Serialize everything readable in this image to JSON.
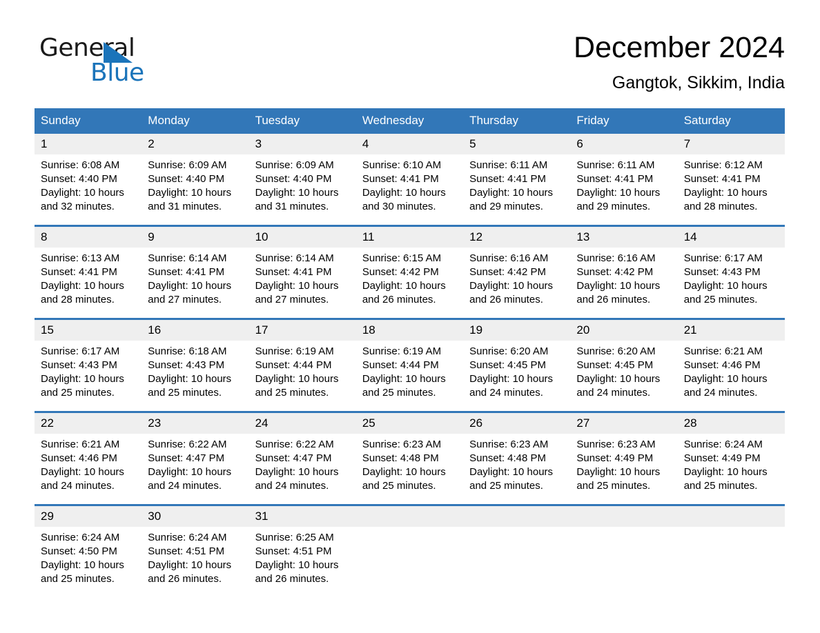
{
  "brand": {
    "name_part1": "General",
    "name_part2": "Blue",
    "logo_icon": "triangle-logo-mark",
    "accent_color": "#1b74ba"
  },
  "header": {
    "title": "December 2024",
    "subtitle": "Gangtok, Sikkim, India"
  },
  "colors": {
    "header_blue": "#3277b8",
    "daynum_band": "#efefef",
    "text": "#000000"
  },
  "weekday_headers": [
    "Sunday",
    "Monday",
    "Tuesday",
    "Wednesday",
    "Thursday",
    "Friday",
    "Saturday"
  ],
  "weeks": [
    [
      {
        "day": "1",
        "sunrise": "Sunrise: 6:08 AM",
        "sunset": "Sunset: 4:40 PM",
        "daylight": "Daylight: 10 hours and 32 minutes."
      },
      {
        "day": "2",
        "sunrise": "Sunrise: 6:09 AM",
        "sunset": "Sunset: 4:40 PM",
        "daylight": "Daylight: 10 hours and 31 minutes."
      },
      {
        "day": "3",
        "sunrise": "Sunrise: 6:09 AM",
        "sunset": "Sunset: 4:40 PM",
        "daylight": "Daylight: 10 hours and 31 minutes."
      },
      {
        "day": "4",
        "sunrise": "Sunrise: 6:10 AM",
        "sunset": "Sunset: 4:41 PM",
        "daylight": "Daylight: 10 hours and 30 minutes."
      },
      {
        "day": "5",
        "sunrise": "Sunrise: 6:11 AM",
        "sunset": "Sunset: 4:41 PM",
        "daylight": "Daylight: 10 hours and 29 minutes."
      },
      {
        "day": "6",
        "sunrise": "Sunrise: 6:11 AM",
        "sunset": "Sunset: 4:41 PM",
        "daylight": "Daylight: 10 hours and 29 minutes."
      },
      {
        "day": "7",
        "sunrise": "Sunrise: 6:12 AM",
        "sunset": "Sunset: 4:41 PM",
        "daylight": "Daylight: 10 hours and 28 minutes."
      }
    ],
    [
      {
        "day": "8",
        "sunrise": "Sunrise: 6:13 AM",
        "sunset": "Sunset: 4:41 PM",
        "daylight": "Daylight: 10 hours and 28 minutes."
      },
      {
        "day": "9",
        "sunrise": "Sunrise: 6:14 AM",
        "sunset": "Sunset: 4:41 PM",
        "daylight": "Daylight: 10 hours and 27 minutes."
      },
      {
        "day": "10",
        "sunrise": "Sunrise: 6:14 AM",
        "sunset": "Sunset: 4:41 PM",
        "daylight": "Daylight: 10 hours and 27 minutes."
      },
      {
        "day": "11",
        "sunrise": "Sunrise: 6:15 AM",
        "sunset": "Sunset: 4:42 PM",
        "daylight": "Daylight: 10 hours and 26 minutes."
      },
      {
        "day": "12",
        "sunrise": "Sunrise: 6:16 AM",
        "sunset": "Sunset: 4:42 PM",
        "daylight": "Daylight: 10 hours and 26 minutes."
      },
      {
        "day": "13",
        "sunrise": "Sunrise: 6:16 AM",
        "sunset": "Sunset: 4:42 PM",
        "daylight": "Daylight: 10 hours and 26 minutes."
      },
      {
        "day": "14",
        "sunrise": "Sunrise: 6:17 AM",
        "sunset": "Sunset: 4:43 PM",
        "daylight": "Daylight: 10 hours and 25 minutes."
      }
    ],
    [
      {
        "day": "15",
        "sunrise": "Sunrise: 6:17 AM",
        "sunset": "Sunset: 4:43 PM",
        "daylight": "Daylight: 10 hours and 25 minutes."
      },
      {
        "day": "16",
        "sunrise": "Sunrise: 6:18 AM",
        "sunset": "Sunset: 4:43 PM",
        "daylight": "Daylight: 10 hours and 25 minutes."
      },
      {
        "day": "17",
        "sunrise": "Sunrise: 6:19 AM",
        "sunset": "Sunset: 4:44 PM",
        "daylight": "Daylight: 10 hours and 25 minutes."
      },
      {
        "day": "18",
        "sunrise": "Sunrise: 6:19 AM",
        "sunset": "Sunset: 4:44 PM",
        "daylight": "Daylight: 10 hours and 25 minutes."
      },
      {
        "day": "19",
        "sunrise": "Sunrise: 6:20 AM",
        "sunset": "Sunset: 4:45 PM",
        "daylight": "Daylight: 10 hours and 24 minutes."
      },
      {
        "day": "20",
        "sunrise": "Sunrise: 6:20 AM",
        "sunset": "Sunset: 4:45 PM",
        "daylight": "Daylight: 10 hours and 24 minutes."
      },
      {
        "day": "21",
        "sunrise": "Sunrise: 6:21 AM",
        "sunset": "Sunset: 4:46 PM",
        "daylight": "Daylight: 10 hours and 24 minutes."
      }
    ],
    [
      {
        "day": "22",
        "sunrise": "Sunrise: 6:21 AM",
        "sunset": "Sunset: 4:46 PM",
        "daylight": "Daylight: 10 hours and 24 minutes."
      },
      {
        "day": "23",
        "sunrise": "Sunrise: 6:22 AM",
        "sunset": "Sunset: 4:47 PM",
        "daylight": "Daylight: 10 hours and 24 minutes."
      },
      {
        "day": "24",
        "sunrise": "Sunrise: 6:22 AM",
        "sunset": "Sunset: 4:47 PM",
        "daylight": "Daylight: 10 hours and 24 minutes."
      },
      {
        "day": "25",
        "sunrise": "Sunrise: 6:23 AM",
        "sunset": "Sunset: 4:48 PM",
        "daylight": "Daylight: 10 hours and 25 minutes."
      },
      {
        "day": "26",
        "sunrise": "Sunrise: 6:23 AM",
        "sunset": "Sunset: 4:48 PM",
        "daylight": "Daylight: 10 hours and 25 minutes."
      },
      {
        "day": "27",
        "sunrise": "Sunrise: 6:23 AM",
        "sunset": "Sunset: 4:49 PM",
        "daylight": "Daylight: 10 hours and 25 minutes."
      },
      {
        "day": "28",
        "sunrise": "Sunrise: 6:24 AM",
        "sunset": "Sunset: 4:49 PM",
        "daylight": "Daylight: 10 hours and 25 minutes."
      }
    ],
    [
      {
        "day": "29",
        "sunrise": "Sunrise: 6:24 AM",
        "sunset": "Sunset: 4:50 PM",
        "daylight": "Daylight: 10 hours and 25 minutes."
      },
      {
        "day": "30",
        "sunrise": "Sunrise: 6:24 AM",
        "sunset": "Sunset: 4:51 PM",
        "daylight": "Daylight: 10 hours and 26 minutes."
      },
      {
        "day": "31",
        "sunrise": "Sunrise: 6:25 AM",
        "sunset": "Sunset: 4:51 PM",
        "daylight": "Daylight: 10 hours and 26 minutes."
      },
      {
        "day": "",
        "sunrise": "",
        "sunset": "",
        "daylight": ""
      },
      {
        "day": "",
        "sunrise": "",
        "sunset": "",
        "daylight": ""
      },
      {
        "day": "",
        "sunrise": "",
        "sunset": "",
        "daylight": ""
      },
      {
        "day": "",
        "sunrise": "",
        "sunset": "",
        "daylight": ""
      }
    ]
  ]
}
